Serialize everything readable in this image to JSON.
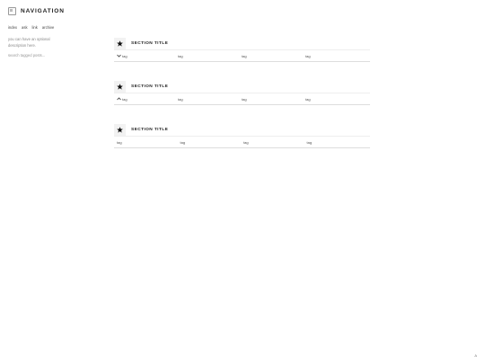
{
  "brand": {
    "title": "NAVIGATION"
  },
  "nav": [
    {
      "label": "index"
    },
    {
      "label": "ask"
    },
    {
      "label": "link"
    },
    {
      "label": "archive"
    }
  ],
  "description": "you can have an optional description here.",
  "search": {
    "label": "search tagged posts..."
  },
  "sections": [
    {
      "title": "SECTION TITLE",
      "tags": [
        "tag",
        "tag",
        "tag",
        "tag"
      ],
      "expanded": true
    },
    {
      "title": "SECTION TITLE",
      "tags": [
        "tag",
        "tag",
        "tag",
        "tag"
      ],
      "expanded": true
    },
    {
      "title": "SECTION TITLE",
      "tags": [
        "tag",
        "tag",
        "tag",
        "tag"
      ],
      "expanded": false
    }
  ],
  "corner": {
    "label": "A"
  },
  "colors": {
    "divider": "#dddddd",
    "icon_bg": "#f2f2f2",
    "title": "#222222"
  }
}
